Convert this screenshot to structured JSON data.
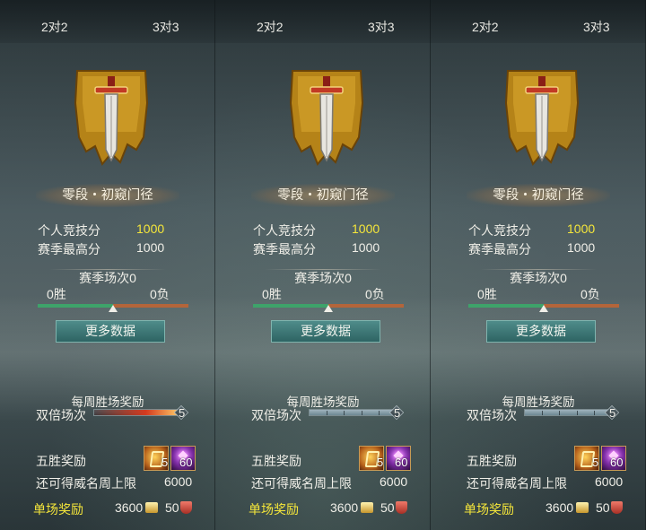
{
  "panels": [
    {
      "tabs": {
        "left": "2对2",
        "right": "3对3"
      },
      "rank_name": "零段・初窥门径",
      "personal_score_label": "个人竞技分",
      "personal_score": "1000",
      "season_best_label": "赛季最高分",
      "season_best": "1000",
      "season_matches": "赛季场次0",
      "wins": "0胜",
      "losses": "0负",
      "win_ratio": 0.5,
      "more_data_button": "更多数据",
      "weekly_title": "每周胜场奖励",
      "double_label": "双倍场次",
      "double_count": "5",
      "double_style": "fire",
      "double_fill": 1.0,
      "five_win_label": "五胜奖励",
      "reward_item_1_count": "5",
      "reward_item_2_count": "60",
      "cap_label": "还可得威名周上限",
      "cap_value": "6000",
      "single_label": "单场奖励",
      "single_value_1": "3600",
      "single_value_2": "50"
    },
    {
      "tabs": {
        "left": "2对2",
        "right": "3对3"
      },
      "rank_name": "零段・初窥门径",
      "personal_score_label": "个人竞技分",
      "personal_score": "1000",
      "season_best_label": "赛季最高分",
      "season_best": "1000",
      "season_matches": "赛季场次0",
      "wins": "0胜",
      "losses": "0负",
      "win_ratio": 0.5,
      "more_data_button": "更多数据",
      "weekly_title": "每周胜场奖励",
      "double_label": "双倍场次",
      "double_count": "5",
      "double_style": "blue",
      "double_fill": 1.0,
      "five_win_label": "五胜奖励",
      "reward_item_1_count": "5",
      "reward_item_2_count": "60",
      "cap_label": "还可得威名周上限",
      "cap_value": "6000",
      "single_label": "单场奖励",
      "single_value_1": "3600",
      "single_value_2": "50"
    },
    {
      "tabs": {
        "left": "2对2",
        "right": "3对3"
      },
      "rank_name": "零段・初窥门径",
      "personal_score_label": "个人竞技分",
      "personal_score": "1000",
      "season_best_label": "赛季最高分",
      "season_best": "1000",
      "season_matches": "赛季场次0",
      "wins": "0胜",
      "losses": "0负",
      "win_ratio": 0.5,
      "more_data_button": "更多数据",
      "weekly_title": "每周胜场奖励",
      "double_label": "双倍场次",
      "double_count": "5",
      "double_style": "blue",
      "double_fill": 1.0,
      "five_win_label": "五胜奖励",
      "reward_item_1_count": "5",
      "reward_item_2_count": "60",
      "cap_label": "还可得威名周上限",
      "cap_value": "6000",
      "single_label": "单场奖励",
      "single_value_1": "3600",
      "single_value_2": "50"
    }
  ],
  "colors": {
    "highlight_gold": "#f5e63a",
    "win_bar": "#3ea36a",
    "loss_bar": "#b4653a",
    "button_teal": "#2e6463"
  },
  "icons": {
    "rank_emblem": "sword-banner-icon",
    "reward_item_1": "talisman-icon",
    "reward_item_2": "purple-gem-icon",
    "currency_1": "coin-icon",
    "currency_2": "shield-icon"
  }
}
